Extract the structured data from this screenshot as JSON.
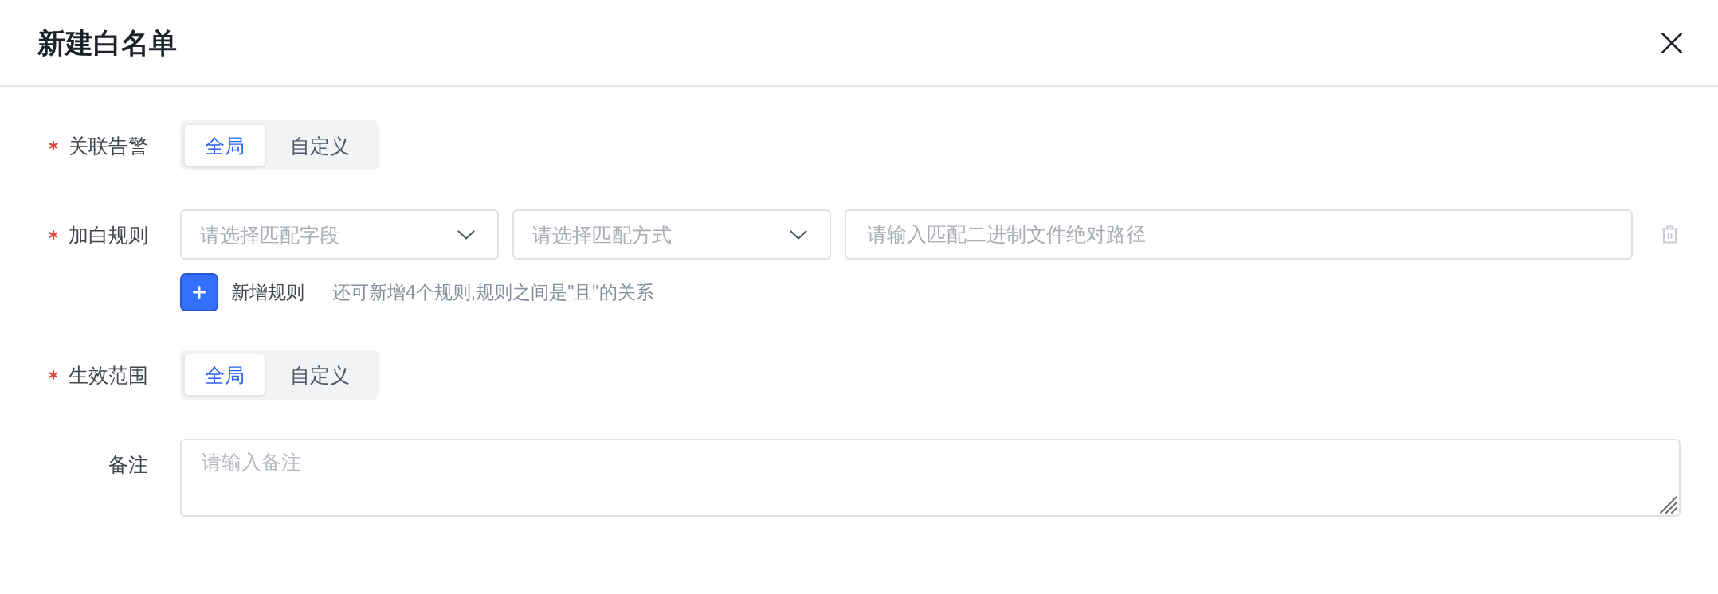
{
  "dialog": {
    "title": "新建白名单"
  },
  "fields": [
    {
      "kind": "segmented",
      "label": "关联告警",
      "required": true,
      "options": [
        {
          "label": "全局",
          "selected": true
        },
        {
          "label": "自定义",
          "selected": false
        }
      ]
    },
    {
      "kind": "rules",
      "label": "加白规则",
      "required": true,
      "rules": [
        {
          "field": {
            "placeholder": "请选择匹配字段"
          },
          "method": {
            "placeholder": "请选择匹配方式"
          },
          "value": {
            "placeholder": "请输入匹配二进制文件绝对路径"
          }
        }
      ],
      "add_button": "新增规则",
      "hint": "还可新增4个规则,规则之间是\"且\"的关系"
    },
    {
      "kind": "segmented",
      "label": "生效范围",
      "required": true,
      "options": [
        {
          "label": "全局",
          "selected": true
        },
        {
          "label": "自定义",
          "selected": false
        }
      ]
    },
    {
      "kind": "textarea",
      "label": "备注",
      "required": false,
      "placeholder": "请输入备注"
    }
  ]
}
